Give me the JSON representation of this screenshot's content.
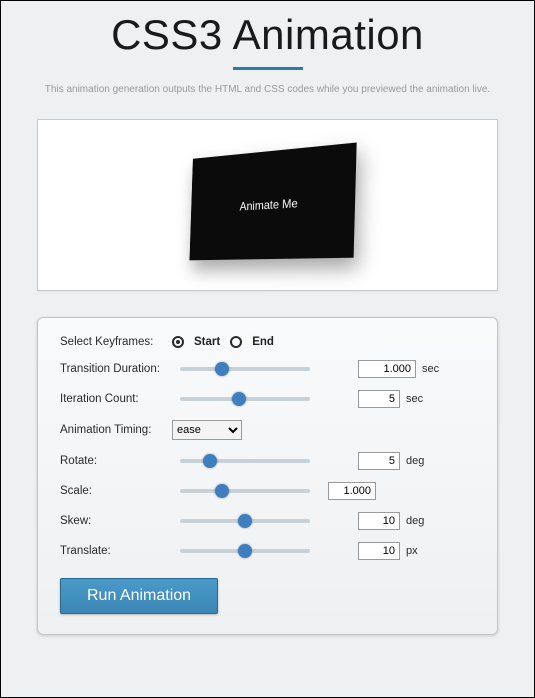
{
  "header": {
    "title": "CSS3 Animation",
    "subtitle": "This animation generation outputs the HTML and CSS codes while you previewed the animation live."
  },
  "preview": {
    "card_label": "Animate Me"
  },
  "form": {
    "keyframes": {
      "label": "Select Keyframes:",
      "options": {
        "start": "Start",
        "end": "End"
      },
      "selected": "start"
    },
    "duration": {
      "label": "Transition Duration:",
      "value": "1.000",
      "unit": "sec"
    },
    "iterations": {
      "label": "Iteration Count:",
      "value": "5",
      "unit": "sec"
    },
    "timing": {
      "label": "Animation Timing:",
      "value": "ease"
    },
    "rotate": {
      "label": "Rotate:",
      "value": "5",
      "unit": "deg"
    },
    "scale": {
      "label": "Scale:",
      "value": "1.000"
    },
    "skew": {
      "label": "Skew:",
      "value": "10",
      "unit": "deg"
    },
    "translate": {
      "label": "Translate:",
      "value": "10",
      "unit": "px"
    },
    "run_label": "Run Animation"
  }
}
